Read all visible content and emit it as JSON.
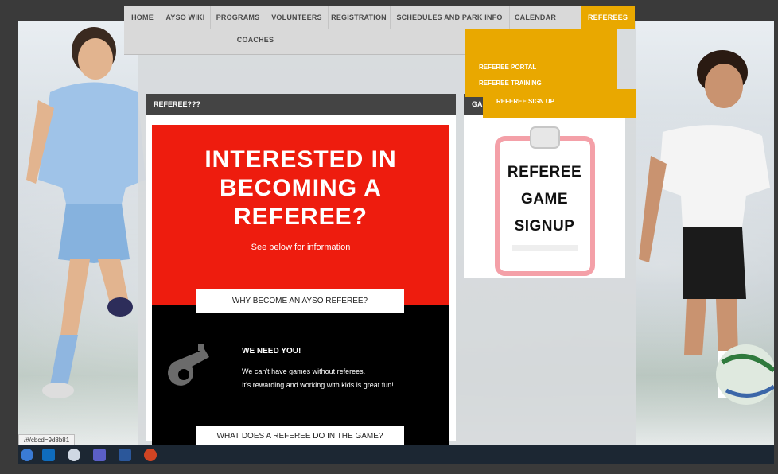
{
  "nav": {
    "items": [
      "HOME",
      "AYSO WIKI",
      "PROGRAMS",
      "VOLUNTEERS",
      "REGISTRATION",
      "SCHEDULES AND PARK INFO",
      "CALENDAR",
      "REFEREES"
    ],
    "row2": [
      "COACHES"
    ],
    "active": "REFEREES"
  },
  "dropdown": {
    "items": [
      "REFEREE PORTAL",
      "REFEREE TRAINING",
      "REFEREE SIGN UP"
    ]
  },
  "left_panel": {
    "title": "REFEREE???",
    "headline": [
      "INTERESTED IN",
      "BECOMING A",
      "REFEREE?"
    ],
    "subtitle": "See below for information",
    "why_button": "WHY BECOME AN AYSO REFEREE?",
    "need_title": "WE NEED YOU!",
    "need_lines": [
      "We can't have games without referees.",
      "It's rewarding and working with kids is great fun!"
    ],
    "what_button": "WHAT DOES A REFEREE DO IN THE GAME?"
  },
  "right_panel": {
    "title": "GA",
    "clipboard_text": [
      "REFEREE",
      "GAME",
      "SIGNUP"
    ]
  },
  "status_url": "/#/cbcd=9d8b81",
  "taskbar": {
    "icons": [
      "windows-start-icon",
      "outlook-icon",
      "browser-icon",
      "teams-icon",
      "word-icon",
      "powerpoint-icon"
    ]
  },
  "colors": {
    "accent": "#e9a800",
    "red": "#ee1c0e",
    "header_dark": "#444444"
  }
}
